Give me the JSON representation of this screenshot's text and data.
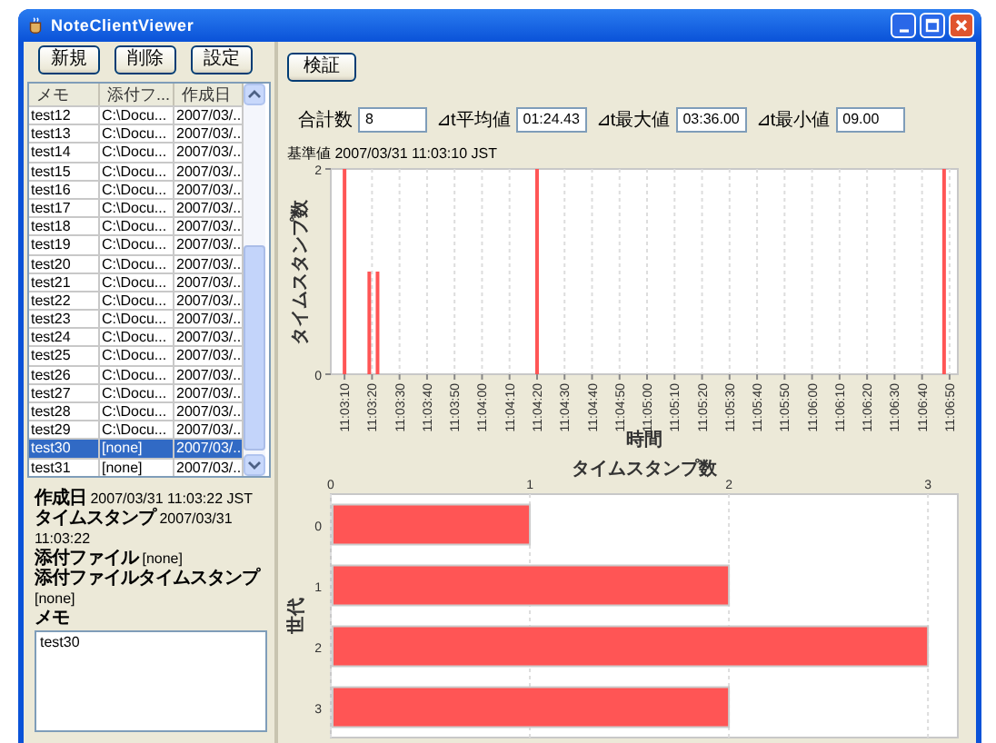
{
  "window": {
    "title": "NoteClientViewer"
  },
  "left": {
    "buttons": [
      "新規",
      "削除",
      "設定"
    ],
    "table": {
      "columns": [
        "メモ",
        "添付フ...",
        "作成日"
      ],
      "rows": [
        {
          "cells": [
            "test12",
            "C:\\Docu...",
            "2007/03/..."
          ],
          "selected": false
        },
        {
          "cells": [
            "test13",
            "C:\\Docu...",
            "2007/03/..."
          ],
          "selected": false
        },
        {
          "cells": [
            "test14",
            "C:\\Docu...",
            "2007/03/..."
          ],
          "selected": false
        },
        {
          "cells": [
            "test15",
            "C:\\Docu...",
            "2007/03/..."
          ],
          "selected": false
        },
        {
          "cells": [
            "test16",
            "C:\\Docu...",
            "2007/03/..."
          ],
          "selected": false
        },
        {
          "cells": [
            "test17",
            "C:\\Docu...",
            "2007/03/..."
          ],
          "selected": false
        },
        {
          "cells": [
            "test18",
            "C:\\Docu...",
            "2007/03/..."
          ],
          "selected": false
        },
        {
          "cells": [
            "test19",
            "C:\\Docu...",
            "2007/03/..."
          ],
          "selected": false
        },
        {
          "cells": [
            "test20",
            "C:\\Docu...",
            "2007/03/..."
          ],
          "selected": false
        },
        {
          "cells": [
            "test21",
            "C:\\Docu...",
            "2007/03/..."
          ],
          "selected": false
        },
        {
          "cells": [
            "test22",
            "C:\\Docu...",
            "2007/03/..."
          ],
          "selected": false
        },
        {
          "cells": [
            "test23",
            "C:\\Docu...",
            "2007/03/..."
          ],
          "selected": false
        },
        {
          "cells": [
            "test24",
            "C:\\Docu...",
            "2007/03/..."
          ],
          "selected": false
        },
        {
          "cells": [
            "test25",
            "C:\\Docu...",
            "2007/03/..."
          ],
          "selected": false
        },
        {
          "cells": [
            "test26",
            "C:\\Docu...",
            "2007/03/..."
          ],
          "selected": false
        },
        {
          "cells": [
            "test27",
            "C:\\Docu...",
            "2007/03/..."
          ],
          "selected": false
        },
        {
          "cells": [
            "test28",
            "C:\\Docu...",
            "2007/03/..."
          ],
          "selected": false
        },
        {
          "cells": [
            "test29",
            "C:\\Docu...",
            "2007/03/..."
          ],
          "selected": false
        },
        {
          "cells": [
            "test30",
            "[none]",
            "2007/03/..."
          ],
          "selected": true
        },
        {
          "cells": [
            "test31",
            "[none]",
            "2007/03/..."
          ],
          "selected": false
        }
      ]
    },
    "details": [
      {
        "label": "作成日",
        "value": "2007/03/31 11:03:22 JST"
      },
      {
        "label": "タイムスタンプ",
        "value": "2007/03/31 11:03:22"
      },
      {
        "label": "添付ファイル",
        "value": "[none]"
      },
      {
        "label": "添付ファイルタイムスタンプ",
        "value": "[none]"
      }
    ],
    "memo": {
      "label": "メモ",
      "value": "test30"
    }
  },
  "right": {
    "button": "検証",
    "stats": [
      {
        "label": "合計数",
        "value": "8"
      },
      {
        "label": "⊿t平均値",
        "value": "01:24.43"
      },
      {
        "label": "⊿t最大値",
        "value": "03:36.00"
      },
      {
        "label": "⊿t最小値",
        "value": "09.00"
      }
    ],
    "base": {
      "label": "基準値",
      "value": "2007/03/31 11:03:10 JST"
    },
    "timeline": {
      "chart_data": {
        "type": "bar",
        "xlabel": "時間",
        "ylabel": "タイムスタンプ数",
        "x": [
          39790,
          39799,
          39802,
          39860,
          40008
        ],
        "series": [
          {
            "color": "#ff5555",
            "values": [
              2,
              1,
              1,
              2,
              2
            ]
          }
        ],
        "xlim": [
          39785,
          40013
        ],
        "ylim": [
          0,
          2
        ],
        "yticks": [
          0,
          2
        ],
        "grid": true,
        "xticks": [
          {
            "value": 39790,
            "label": "11:03:10"
          },
          {
            "value": 39800,
            "label": "11:03:20"
          },
          {
            "value": 39810,
            "label": "11:03:30"
          },
          {
            "value": 39820,
            "label": "11:03:40"
          },
          {
            "value": 39830,
            "label": "11:03:50"
          },
          {
            "value": 39840,
            "label": "11:04:00"
          },
          {
            "value": 39850,
            "label": "11:04:10"
          },
          {
            "value": 39860,
            "label": "11:04:20"
          },
          {
            "value": 39870,
            "label": "11:04:30"
          },
          {
            "value": 39880,
            "label": "11:04:40"
          },
          {
            "value": 39890,
            "label": "11:04:50"
          },
          {
            "value": 39900,
            "label": "11:05:00"
          },
          {
            "value": 39910,
            "label": "11:05:10"
          },
          {
            "value": 39920,
            "label": "11:05:20"
          },
          {
            "value": 39930,
            "label": "11:05:30"
          },
          {
            "value": 39940,
            "label": "11:05:40"
          },
          {
            "value": 39950,
            "label": "11:05:50"
          },
          {
            "value": 39960,
            "label": "11:06:00"
          },
          {
            "value": 39970,
            "label": "11:06:10"
          },
          {
            "value": 39980,
            "label": "11:06:20"
          },
          {
            "value": 39990,
            "label": "11:06:30"
          },
          {
            "value": 40000,
            "label": "11:06:40"
          },
          {
            "value": 40010,
            "label": "11:06:50"
          }
        ]
      }
    },
    "histogram": {
      "chart_data": {
        "type": "bar",
        "orientation": "horizontal",
        "xlabel": "タイムスタンプ数",
        "ylabel": "世代",
        "categories": [
          "0",
          "1",
          "2",
          "3"
        ],
        "series": [
          {
            "color": "#ff5555",
            "values": [
              1,
              2,
              3,
              2
            ]
          }
        ],
        "xlim": [
          0,
          3.15
        ],
        "xticks": [
          0,
          1,
          2,
          3
        ],
        "grid": true
      }
    }
  }
}
